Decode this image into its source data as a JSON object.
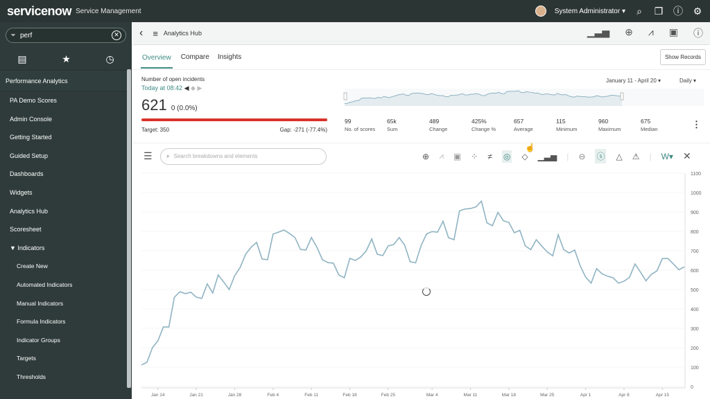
{
  "topbar": {
    "logo": "servicenow",
    "product": "Service Management",
    "user": "System Administrator"
  },
  "sidebar": {
    "filter": "perf",
    "section": "Performance Analytics",
    "items": [
      "PA Demo Scores",
      "Admin Console",
      "Getting Started",
      "Guided Setup",
      "Dashboards",
      "Widgets",
      "Analytics Hub",
      "Scoresheet",
      "▼ Indicators"
    ],
    "subitems": [
      "Create New",
      "Automated Indicators",
      "Manual Indicators",
      "Formula Indicators",
      "Indicator Groups",
      "Targets",
      "Thresholds"
    ]
  },
  "hub": {
    "title": "Analytics Hub",
    "tabs": [
      "Overview",
      "Compare",
      "Insights"
    ],
    "show_records": "Show Records"
  },
  "kpi": {
    "name": "Number of open incidents",
    "today": "Today at 08:42",
    "value": "621",
    "change": "0 (0.0%)",
    "target": "Target: 350",
    "gap": "Gap: -271 (-77.4%)"
  },
  "range": {
    "dates": "January 11 - April 20",
    "period": "Daily"
  },
  "stats": [
    {
      "v": "99",
      "l": "No. of scores"
    },
    {
      "v": "65k",
      "l": "Sum"
    },
    {
      "v": "489",
      "l": "Change"
    },
    {
      "v": "425%",
      "l": "Change %"
    },
    {
      "v": "657",
      "l": "Average"
    },
    {
      "v": "115",
      "l": "Minimum"
    },
    {
      "v": "960",
      "l": "Maximum"
    },
    {
      "v": "675",
      "l": "Median"
    }
  ],
  "toolbar": {
    "search_placeholder": "Search breakdowns and elements"
  },
  "colors": {
    "line": "#8fb3c2",
    "accent": "#3d8a84",
    "target_bar": "#d9332b"
  },
  "chart_data": {
    "type": "line",
    "ylim": [
      0,
      1100
    ],
    "yticks": [
      0,
      100,
      200,
      300,
      400,
      500,
      600,
      700,
      800,
      900,
      1000,
      1100
    ],
    "xticks": [
      "Jan 14",
      "Jan 21",
      "Jan 28",
      "Feb 4",
      "Feb 11",
      "Feb 18",
      "Feb 25",
      "Mar 4",
      "Mar 11",
      "Mar 18",
      "Mar 25",
      "Apr 1",
      "Apr 8",
      "Apr 15"
    ],
    "x": [
      "Jan 11",
      "Jan 12",
      "Jan 13",
      "Jan 14",
      "Jan 15",
      "Jan 16",
      "Jan 17",
      "Jan 18",
      "Jan 19",
      "Jan 20",
      "Jan 21",
      "Jan 22",
      "Jan 23",
      "Jan 24",
      "Jan 25",
      "Jan 26",
      "Jan 27",
      "Jan 28",
      "Jan 29",
      "Jan 30",
      "Jan 31",
      "Feb 1",
      "Feb 2",
      "Feb 3",
      "Feb 4",
      "Feb 5",
      "Feb 6",
      "Feb 7",
      "Feb 8",
      "Feb 9",
      "Feb 10",
      "Feb 11",
      "Feb 12",
      "Feb 13",
      "Feb 14",
      "Feb 15",
      "Feb 16",
      "Feb 17",
      "Feb 18",
      "Feb 19",
      "Feb 20",
      "Feb 21",
      "Feb 22",
      "Feb 23",
      "Feb 24",
      "Feb 25",
      "Feb 26",
      "Feb 27",
      "Feb 28",
      "Feb 29",
      "Mar 1",
      "Mar 2",
      "Mar 3",
      "Mar 4",
      "Mar 5",
      "Mar 6",
      "Mar 7",
      "Mar 8",
      "Mar 9",
      "Mar 10",
      "Mar 11",
      "Mar 12",
      "Mar 13",
      "Mar 14",
      "Mar 15",
      "Mar 16",
      "Mar 17",
      "Mar 18",
      "Mar 19",
      "Mar 20",
      "Mar 21",
      "Mar 22",
      "Mar 23",
      "Mar 24",
      "Mar 25",
      "Mar 26",
      "Mar 27",
      "Mar 28",
      "Mar 29",
      "Mar 30",
      "Mar 31",
      "Apr 1",
      "Apr 2",
      "Apr 3",
      "Apr 4",
      "Apr 5",
      "Apr 6",
      "Apr 7",
      "Apr 8",
      "Apr 9",
      "Apr 10",
      "Apr 11",
      "Apr 12",
      "Apr 13",
      "Apr 14",
      "Apr 15",
      "Apr 16",
      "Apr 17",
      "Apr 18",
      "Apr 19"
    ],
    "values": [
      111,
      125,
      200,
      236,
      307,
      307,
      460,
      489,
      479,
      486,
      461,
      454,
      529,
      482,
      575,
      539,
      500,
      571,
      614,
      682,
      718,
      743,
      657,
      654,
      786,
      796,
      807,
      789,
      768,
      707,
      704,
      768,
      718,
      654,
      639,
      636,
      575,
      561,
      661,
      650,
      668,
      700,
      761,
      682,
      675,
      725,
      732,
      768,
      729,
      643,
      638,
      727,
      787,
      799,
      796,
      852,
      767,
      757,
      906,
      915,
      918,
      926,
      956,
      844,
      829,
      898,
      855,
      846,
      793,
      805,
      725,
      706,
      757,
      724,
      694,
      674,
      783,
      706,
      688,
      704,
      623,
      564,
      533,
      608,
      581,
      569,
      561,
      533,
      543,
      563,
      632,
      590,
      545,
      579,
      596,
      660,
      660,
      632,
      602,
      617
    ]
  }
}
